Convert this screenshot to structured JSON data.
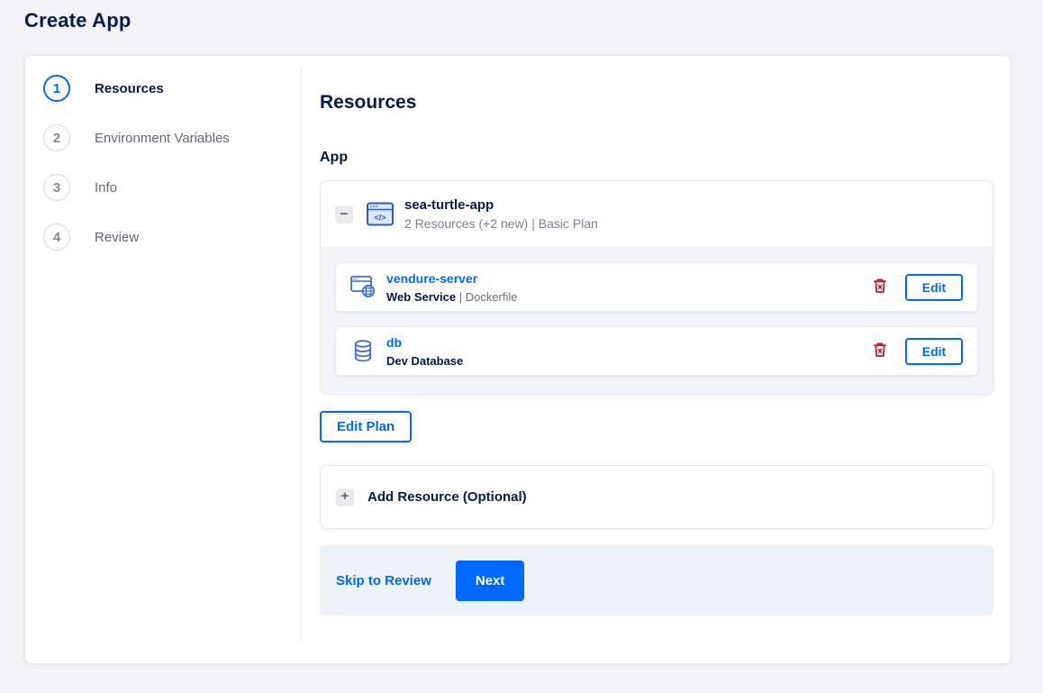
{
  "page": {
    "title": "Create App"
  },
  "colors": {
    "accent": "#0069ff",
    "heading": "#031b4e",
    "danger": "#c41e2e",
    "footer_bg": "#edf2f9"
  },
  "steps": [
    {
      "num": "1",
      "label": "Resources"
    },
    {
      "num": "2",
      "label": "Environment Variables"
    },
    {
      "num": "3",
      "label": "Info"
    },
    {
      "num": "4",
      "label": "Review"
    }
  ],
  "content": {
    "heading": "Resources",
    "section_label": "App",
    "app_group": {
      "collapse_icon": "minus-icon",
      "collapse_glyph": "−",
      "app_icon": "app-window-icon",
      "name": "sea-turtle-app",
      "summary": "2 Resources (+2 new) | Basic Plan",
      "resources": [
        {
          "name": "vendure-server",
          "kind": "Web Service",
          "sep": " | ",
          "source": "Dockerfile",
          "icon": "web-service-icon",
          "delete_icon": "trash-icon",
          "edit_label": "Edit"
        },
        {
          "name": "db",
          "kind": "Dev Database",
          "icon": "database-icon",
          "delete_icon": "trash-icon",
          "edit_label": "Edit"
        }
      ]
    },
    "edit_plan_label": "Edit Plan",
    "add_resource": {
      "icon": "plus-icon",
      "glyph": "+",
      "label": "Add Resource (Optional)"
    },
    "footer": {
      "skip_label": "Skip to Review",
      "next_label": "Next"
    }
  }
}
